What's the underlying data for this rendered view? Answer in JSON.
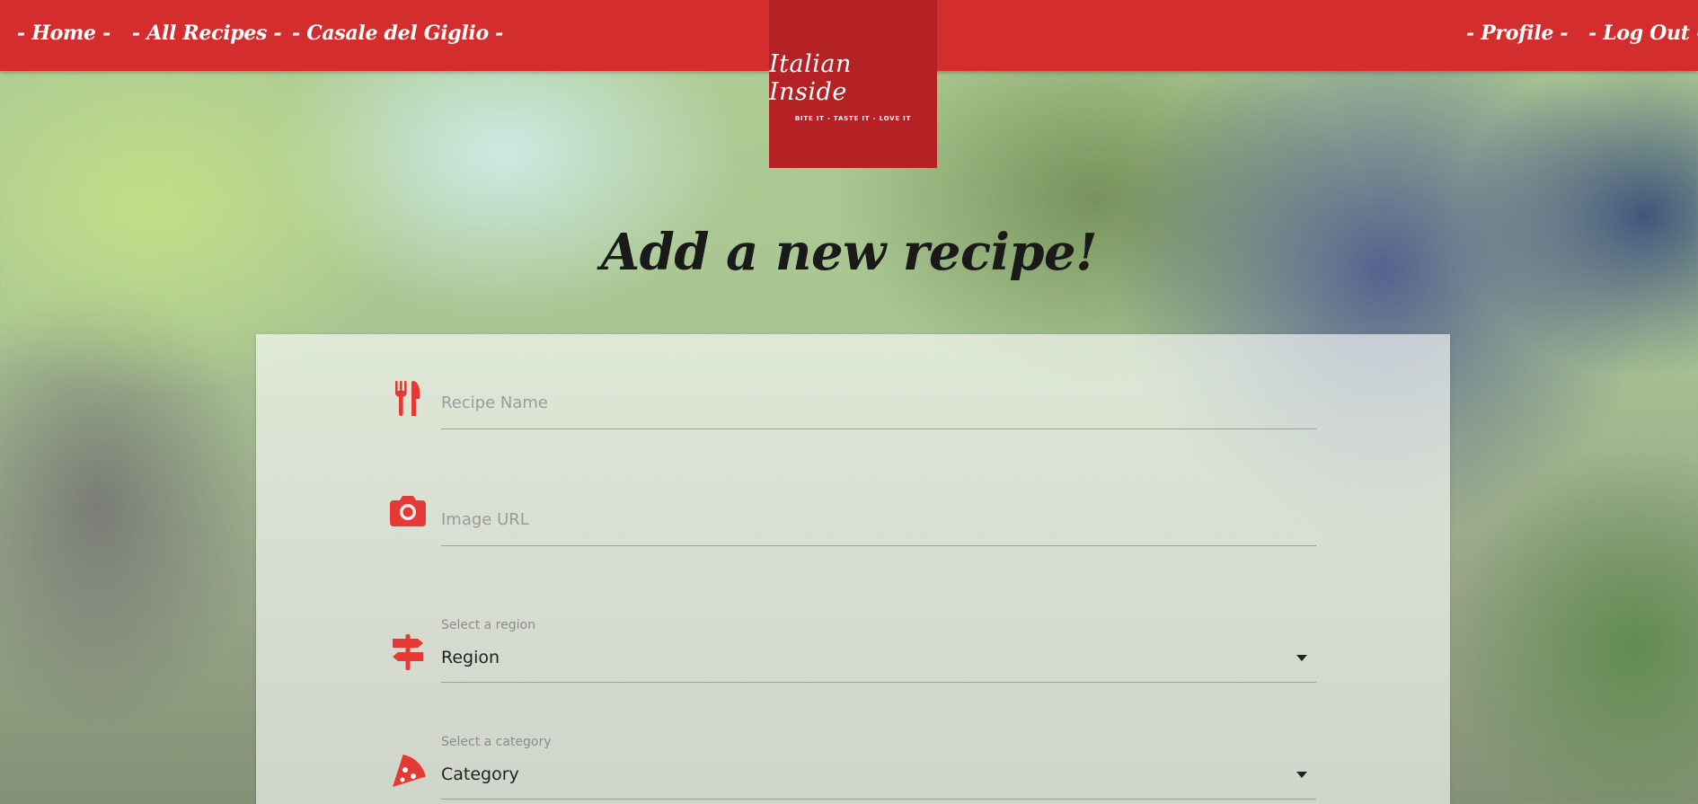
{
  "nav": {
    "home": "- Home -",
    "all_recipes": "- All Recipes -",
    "casale": "- Casale del Giglio -",
    "profile": "- Profile -",
    "logout": "- Log Out -"
  },
  "logo": {
    "title": "Italian Inside",
    "tagline": "BITE IT - TASTE IT - LOVE IT"
  },
  "page": {
    "title": "Add a new recipe!"
  },
  "form": {
    "recipe_name_placeholder": "Recipe Name",
    "image_url_placeholder": "Image URL",
    "region_label": "Select a region",
    "region_value": "Region",
    "category_label": "Select a category",
    "category_value": "Category"
  },
  "icons": {
    "recipe_name": "utensils-icon",
    "image_url": "camera-icon",
    "region": "signpost-icon",
    "category": "pizza-slice-icon",
    "select_caret": "caret-down-icon"
  },
  "colors": {
    "brand_red": "#d42d2d",
    "logo_red": "#b52226",
    "icon_red": "#e53935"
  }
}
